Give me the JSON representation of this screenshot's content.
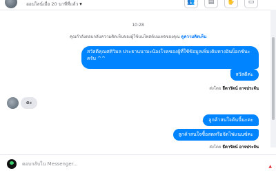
{
  "header": {
    "subtitle": "ออนไลน์เมื่อ 20 นาทีที่แล้ว",
    "actions": [
      "👥",
      "▤",
      "✋",
      "▭"
    ]
  },
  "thread": {
    "timestamp": "10:28",
    "notice_text": "คุณกำลังตอบกลับความคิดเห็นของผู้ใช้บนโพสต์บนเพจของคุณ",
    "notice_link": "ดูความคิดเห็น",
    "messages": {
      "m1": "สวัสดีคุณศศิวิมล ประธานนามะน้องโรคของผู้ที่ใช้ข้อมูลเพิ่มเติมทางอินบ็อกซ์นะครับ ^^",
      "m2": "สวัสดีค่ะ",
      "m3": "ตะ",
      "m4": "ลูกค้าสนใจต้นนี้นะคะ",
      "m5": "ลูกค้าสนใจซื้อสดหรือจัดไฟแนนซ์คะ"
    },
    "sent_by_label": "ส่งโดย",
    "sent_by_name": "ธีดารัตน์ อาจประจัน"
  },
  "composer": {
    "placeholder": "ตอบกลับใน Messenger..."
  },
  "colors": {
    "accent": "#0084ff",
    "incoming_bubble": "#e4e6eb",
    "link": "#0a7cff"
  }
}
